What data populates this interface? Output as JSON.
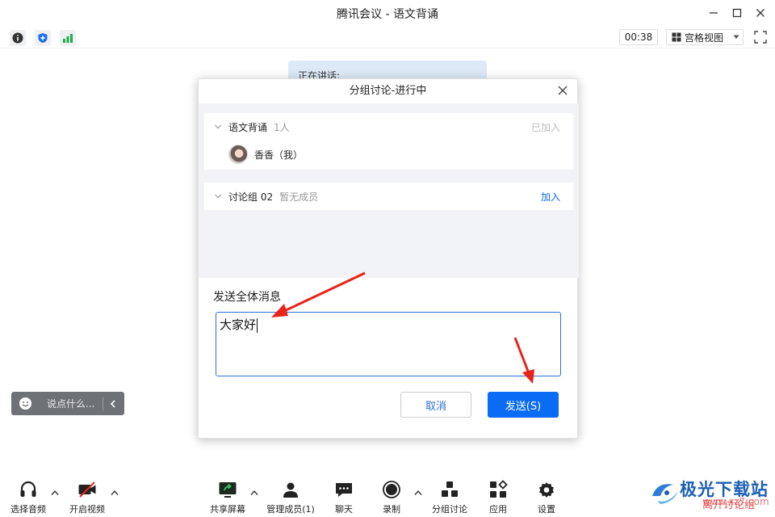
{
  "window": {
    "title": "腾讯会议 - 语文背诵",
    "minimize_icon": "minimize-icon",
    "maximize_icon": "maximize-icon",
    "close_icon": "close-icon"
  },
  "toolbar": {
    "timer": "00:38",
    "view_label": "宫格视图"
  },
  "stage": {
    "speaking_label": "正在讲话:"
  },
  "dialog": {
    "title": "分组讨论-进行中",
    "groups": [
      {
        "name": "语文背诵",
        "count": "1人",
        "status": "已加入",
        "members": [
          {
            "name": "香香（我）"
          }
        ]
      },
      {
        "name": "讨论组 02",
        "count": "暂无成员",
        "action": "加入"
      }
    ],
    "message_label": "发送全体消息",
    "message_value": "大家好",
    "cancel_label": "取消",
    "send_label": "发送(S)"
  },
  "chat": {
    "placeholder": "说点什么..."
  },
  "bottombar": {
    "items": [
      {
        "label": "选择音频",
        "icon": "headset-icon"
      },
      {
        "label": "开启视频",
        "icon": "camera-off-icon"
      },
      {
        "label": "共享屏幕",
        "icon": "share-screen-icon"
      },
      {
        "label": "管理成员(1)",
        "icon": "members-icon"
      },
      {
        "label": "聊天",
        "icon": "chat-icon"
      },
      {
        "label": "录制",
        "icon": "record-icon"
      },
      {
        "label": "分组讨论",
        "icon": "breakout-icon"
      },
      {
        "label": "应用",
        "icon": "apps-icon"
      },
      {
        "label": "设置",
        "icon": "settings-icon"
      }
    ]
  },
  "watermark": {
    "brand": "极光下载站",
    "sub": "离开讨论组",
    "url": "www.xz7.com"
  },
  "colors": {
    "accent": "#0a6cf5",
    "annotation_arrow": "#e8231a"
  }
}
